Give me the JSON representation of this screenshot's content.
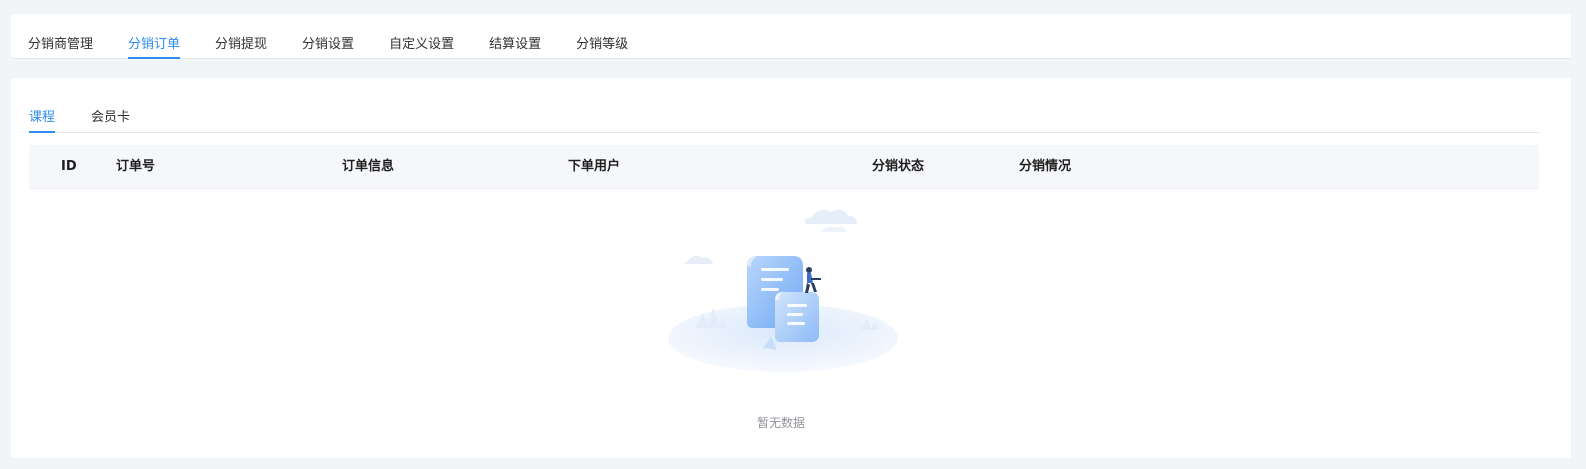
{
  "top_tabs": [
    {
      "label": "分销商管理",
      "active": false
    },
    {
      "label": "分销订单",
      "active": true
    },
    {
      "label": "分销提现",
      "active": false
    },
    {
      "label": "分销设置",
      "active": false
    },
    {
      "label": "自定义设置",
      "active": false
    },
    {
      "label": "结算设置",
      "active": false
    },
    {
      "label": "分销等级",
      "active": false
    }
  ],
  "sub_tabs": [
    {
      "label": "课程",
      "active": true
    },
    {
      "label": "会员卡",
      "active": false
    }
  ],
  "table": {
    "columns": [
      "ID",
      "订单号",
      "订单信息",
      "下单用户",
      "分销状态",
      "分销情况"
    ]
  },
  "empty_state": {
    "text": "暂无数据",
    "icon": "empty-documents-illustration"
  },
  "colors": {
    "accent": "#2d8cf0",
    "page_bg": "#f2f5f8",
    "header_bg": "#f5f7fa"
  }
}
